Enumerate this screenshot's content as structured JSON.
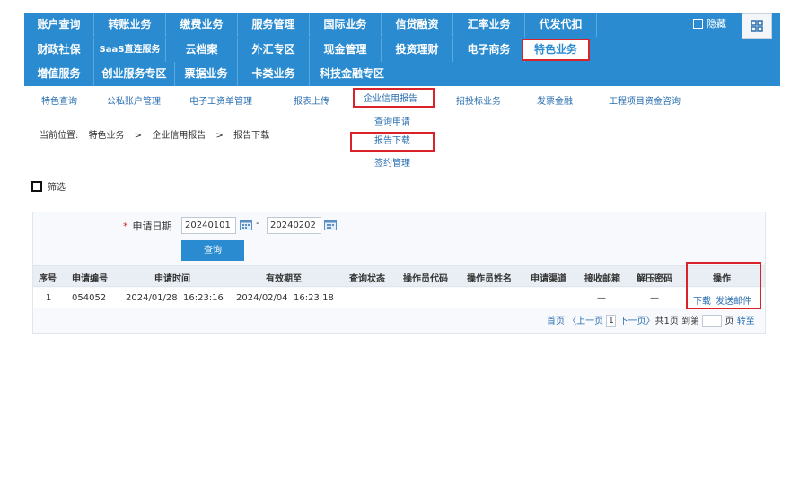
{
  "topnav": {
    "row1": [
      "账户查询",
      "转账业务",
      "缴费业务",
      "服务管理",
      "国际业务",
      "信贷融资",
      "汇率业务",
      "代发代扣"
    ],
    "row2": [
      "财政社保",
      "SaaS直连服务",
      "云档案",
      "外汇专区",
      "现金管理",
      "投资理财",
      "电子商务",
      "特色业务"
    ],
    "row3": [
      "增值服务",
      "创业服务专区",
      "票据业务",
      "卡类业务",
      "科技金融专区"
    ],
    "hide_label": "隐藏"
  },
  "subnav": [
    "特色查询",
    "公私账户管理",
    "电子工资单管理",
    "报表上传",
    "企业信用报告",
    "招投标业务",
    "发票金融",
    "工程项目资金咨询"
  ],
  "dropdown": [
    "查询申请",
    "报告下载",
    "签约管理"
  ],
  "breadcrumb": {
    "label": "当前位置:",
    "items": [
      "特色业务",
      ">",
      "企业信用报告",
      ">",
      "报告下载"
    ]
  },
  "filter_label": "筛选",
  "form": {
    "required_mark": "*",
    "date_label": "申请日期",
    "start_date": "20240101",
    "dash": "-",
    "end_date": "20240202",
    "query_button": "查询"
  },
  "table": {
    "headers": [
      "序号",
      "申请编号",
      "申请时间",
      "有效期至",
      "查询状态",
      "操作员代码",
      "操作员姓名",
      "申请渠道",
      "接收邮箱",
      "解压密码",
      "操作"
    ],
    "rows": [
      {
        "index": "1",
        "apply_no": "054052",
        "apply_time": "2024/01/28  16:23:16",
        "expire_time": "2024/02/04  16:23:18",
        "email": "—",
        "password": "—",
        "download": "下载",
        "send": "发送邮件"
      }
    ]
  },
  "pager": {
    "first": "首页",
    "prev": "〈上一页",
    "page": "1",
    "next": "下一页〉",
    "total": "共1页",
    "goto": "到第",
    "page_unit": "页",
    "jump": "转至"
  }
}
